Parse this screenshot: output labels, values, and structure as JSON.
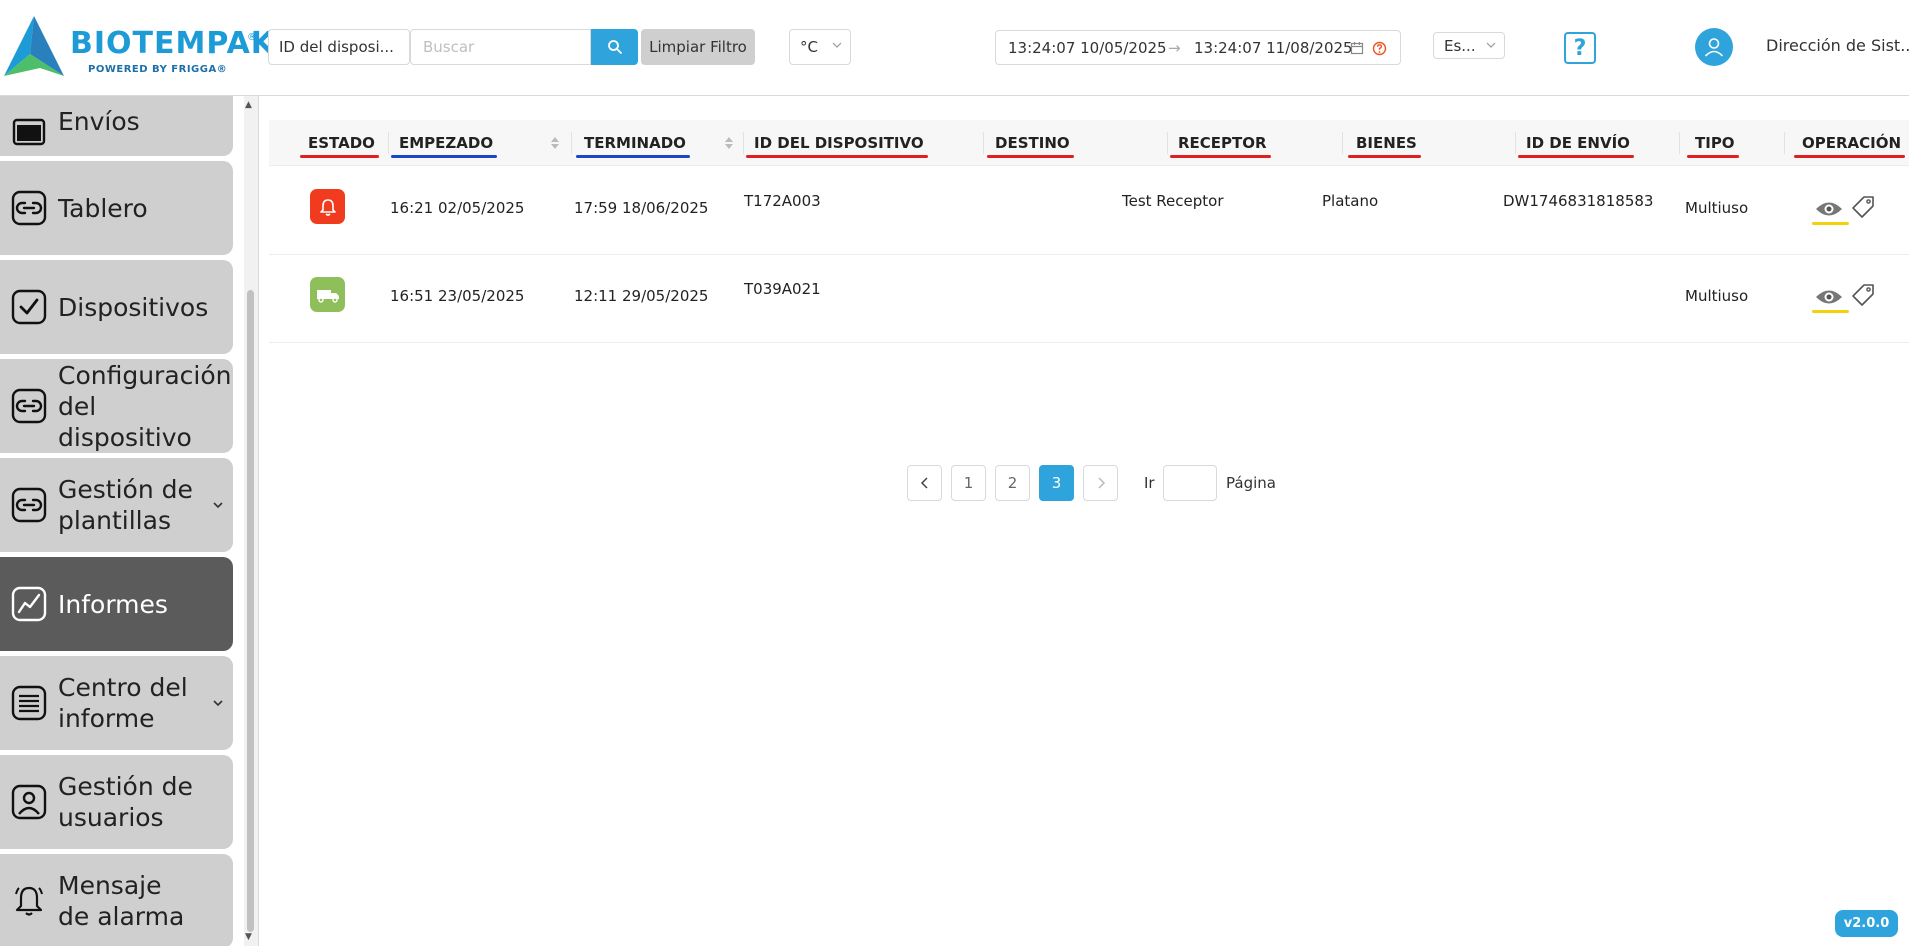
{
  "brand": {
    "name": "BIOTEMPAK",
    "tagline": "POWERED BY FRIGGA",
    "registered": "®"
  },
  "header": {
    "filter_field": "ID del disposi...",
    "search_placeholder": "Buscar",
    "clear_label": "Limpiar Filtro",
    "unit": "°C",
    "date_start": "13:24:07 10/05/2025",
    "date_separator": "→",
    "date_end": "13:24:07 11/08/2025",
    "language": "Es...",
    "help": "?",
    "user_name": "Dirección de Sist..."
  },
  "sidebar": {
    "items": [
      {
        "label": "Envíos",
        "icon": "shipment-icon"
      },
      {
        "label": "Tablero",
        "icon": "link-icon"
      },
      {
        "label": "Dispositivos",
        "icon": "checkbox-icon"
      },
      {
        "label": "Configuración del dispositivo",
        "icon": "link-icon"
      },
      {
        "label": "Gestión de plantillas",
        "icon": "link-icon"
      },
      {
        "label": "Informes",
        "icon": "chart-line-icon"
      },
      {
        "label": "Centro del informe",
        "icon": "report-list-icon"
      },
      {
        "label": "Gestión de usuarios",
        "icon": "user-icon"
      },
      {
        "label": "Mensaje de alarma",
        "icon": "bell-icon"
      }
    ],
    "active": "Informes"
  },
  "table": {
    "columns": [
      "ESTADO",
      "EMPEZADO",
      "TERMINADO",
      "ID DEL DISPOSITIVO",
      "DESTINO",
      "RECEPTOR",
      "BIENES",
      "ID DE ENVÍO",
      "TIPO",
      "OPERACIÓN"
    ],
    "rows": [
      {
        "status": "alarm",
        "status_color": "#f03b1e",
        "started": "16:21 02/05/2025",
        "ended": "17:59 18/06/2025",
        "device_id": "T172A003",
        "destination": "",
        "receiver": "Test Receptor",
        "goods": "Platano",
        "shipment_id": "DW1746831818583",
        "type": "Multiuso"
      },
      {
        "status": "in-transit",
        "status_color": "#8fbf5a",
        "started": "16:51 23/05/2025",
        "ended": "12:11 29/05/2025",
        "device_id": "T039A021",
        "destination": "",
        "receiver": "",
        "goods": "",
        "shipment_id": "",
        "type": "Multiuso"
      }
    ]
  },
  "pagination": {
    "pages": [
      "1",
      "2",
      "3"
    ],
    "current": "3",
    "go_label": "Ir",
    "page_label": "Página"
  },
  "version": "v2.0.0",
  "colors": {
    "accent": "#2fa3dc",
    "active_nav": "#5b5b5b",
    "nav": "#cfcfcf",
    "underline_red": "#e02020",
    "underline_blue": "#1a47c6",
    "underline_yellow": "#f4d10b"
  }
}
